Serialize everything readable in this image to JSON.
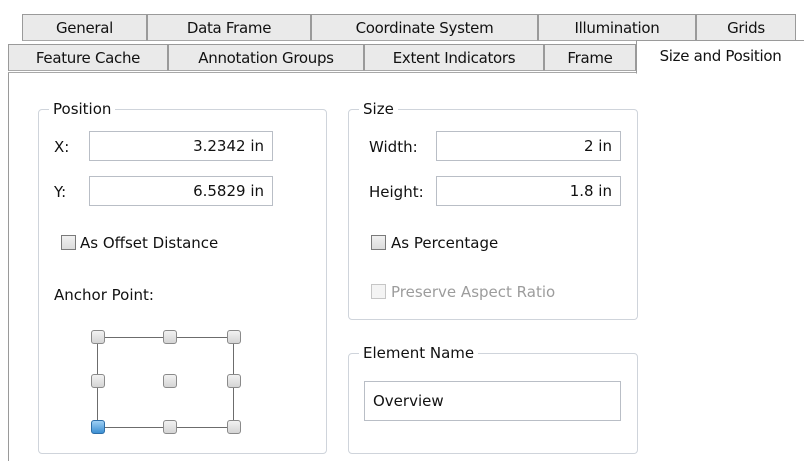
{
  "tabs_row1": [
    {
      "label": "General"
    },
    {
      "label": "Data Frame"
    },
    {
      "label": "Coordinate System"
    },
    {
      "label": "Illumination"
    },
    {
      "label": "Grids"
    }
  ],
  "tabs_row2": [
    {
      "label": "Feature Cache"
    },
    {
      "label": "Annotation Groups"
    },
    {
      "label": "Extent Indicators"
    },
    {
      "label": "Frame"
    },
    {
      "label": "Size and Position",
      "active": true
    }
  ],
  "position": {
    "title": "Position",
    "x_label": "X:",
    "x_value": "3.2342 in",
    "y_label": "Y:",
    "y_value": "6.5829 in",
    "offset_label": "As Offset Distance",
    "offset_checked": false,
    "anchor_label": "Anchor Point:",
    "anchor_selected": "bottom-left"
  },
  "size": {
    "title": "Size",
    "width_label": "Width:",
    "width_value": "2 in",
    "height_label": "Height:",
    "height_value": "1.8 in",
    "percentage_label": "As Percentage",
    "percentage_checked": false,
    "aspect_label": "Preserve Aspect Ratio",
    "aspect_checked": false,
    "aspect_enabled": false
  },
  "element_name": {
    "title": "Element Name",
    "value": "Overview"
  }
}
